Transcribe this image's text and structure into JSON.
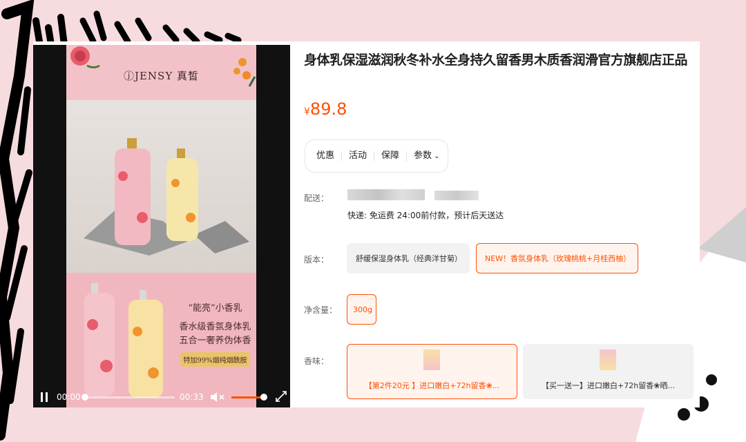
{
  "product": {
    "title": "身体乳保湿滋润秋冬补水全身持久留香男木质香润滑官方旗舰店正品",
    "price_symbol": "¥",
    "price": "89.8"
  },
  "tabs": [
    {
      "label": "优惠"
    },
    {
      "label": "活动"
    },
    {
      "label": "保障"
    },
    {
      "label": "参数"
    }
  ],
  "delivery": {
    "label": "配送：",
    "text": "快递: 免运费  24:00前付款，预计后天送达"
  },
  "version": {
    "label": "版本：",
    "options": [
      {
        "label": "舒缓保湿身体乳（经典洋甘菊）",
        "selected": false
      },
      {
        "label": "NEW！香氛身体乳（玫瑰桃桃+月桂西柚）",
        "selected": true
      }
    ]
  },
  "net_content": {
    "label": "净含量：",
    "options": [
      {
        "label": "300g",
        "selected": true
      }
    ]
  },
  "scent": {
    "label": "香味：",
    "options": [
      {
        "label": "【第2件20元 】进口嫩白+72h留香❀...",
        "selected": true
      },
      {
        "label": "【买一送一】进口嫩白+72h留香❀晒...",
        "selected": false
      }
    ]
  },
  "video": {
    "brand": "ⓙJENSY 真皙",
    "promo_line1": "“能亮”小香乳",
    "promo_line2": "香水级香氛身体乳",
    "promo_line3": "五合一奢养伪体香",
    "promo_tag": "特加99%烟纯烟酰胺",
    "time_current": "00:00",
    "time_total": "00:33",
    "progress_fraction": 0.0,
    "volume_fraction": 0.9
  },
  "colors": {
    "accent": "#ff5000",
    "background": "#f6dcdf"
  }
}
